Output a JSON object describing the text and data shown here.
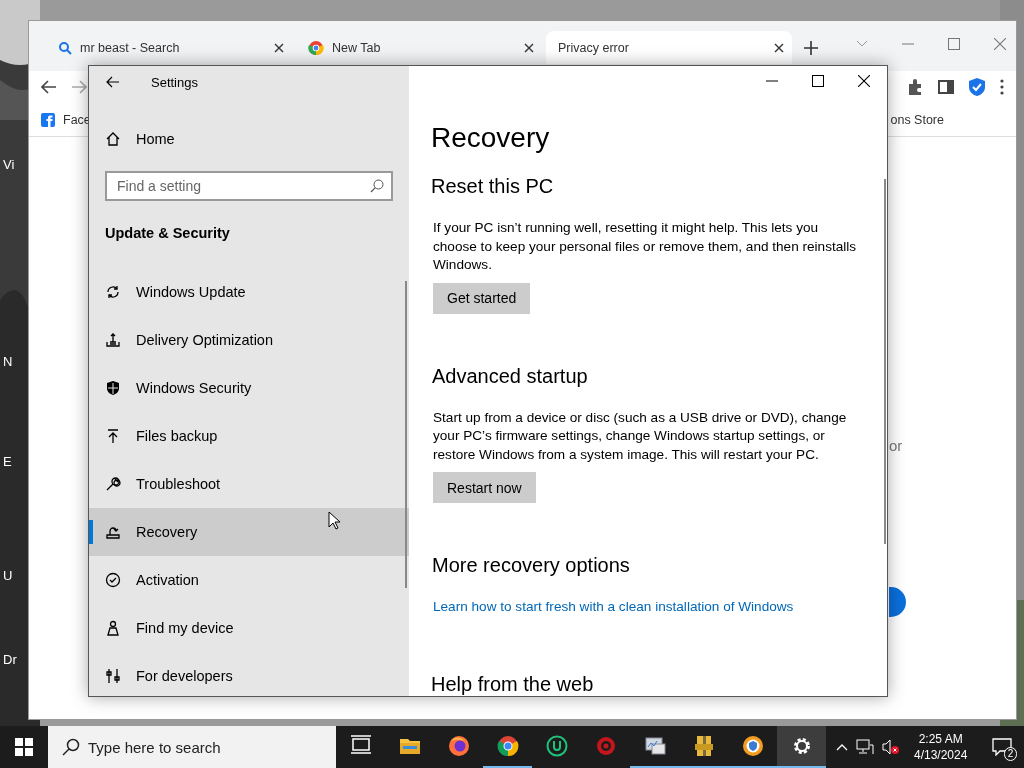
{
  "desktop": {
    "icon_labels": [
      "Vi",
      "N",
      "E",
      "U",
      "Dr"
    ]
  },
  "browser": {
    "tabs": [
      {
        "title": "mr beast - Search",
        "kind": "search",
        "selected": false
      },
      {
        "title": "New Tab",
        "kind": "newtab",
        "selected": false
      },
      {
        "title": "Privacy error",
        "kind": "plain",
        "selected": true
      }
    ],
    "bookmarks": [
      {
        "label": "Face",
        "kind": "facebook"
      },
      {
        "label": "ons Store",
        "kind": "plain"
      }
    ],
    "page_fragment": "or"
  },
  "settings": {
    "title": "Settings",
    "home": "Home",
    "search": {
      "placeholder": "Find a setting"
    },
    "section": "Update & Security",
    "nav": [
      {
        "label": "Windows Update",
        "kind": "sync",
        "selected": false
      },
      {
        "label": "Delivery Optimization",
        "kind": "delivery",
        "selected": false
      },
      {
        "label": "Windows Security",
        "kind": "shield",
        "selected": false
      },
      {
        "label": "Files backup",
        "kind": "backup",
        "selected": false
      },
      {
        "label": "Troubleshoot",
        "kind": "wrench",
        "selected": false
      },
      {
        "label": "Recovery",
        "kind": "recovery",
        "selected": true
      },
      {
        "label": "Activation",
        "kind": "check",
        "selected": false
      },
      {
        "label": "Find my device",
        "kind": "person",
        "selected": false
      },
      {
        "label": "For developers",
        "kind": "developer",
        "selected": false
      }
    ],
    "content": {
      "title": "Recovery",
      "sections": [
        {
          "heading": "Reset this PC",
          "text": "If your PC isn’t running well, resetting it might help. This lets you choose to keep your personal files or remove them, and then reinstalls Windows.",
          "button": "Get started"
        },
        {
          "heading": "Advanced startup",
          "text": "Start up from a device or disc (such as a USB drive or DVD), change your PC’s firmware settings, change Windows startup settings, or restore Windows from a system image. This will restart your PC.",
          "button": "Restart now"
        },
        {
          "heading": "More recovery options",
          "link": "Learn how to start fresh with a clean installation of Windows"
        },
        {
          "heading": "Help from the web"
        }
      ]
    }
  },
  "taskbar": {
    "search_placeholder": "Type here to search",
    "apps": [
      {
        "kind": "taskview",
        "running": false,
        "selected": false
      },
      {
        "kind": "explorer",
        "running": false,
        "selected": false
      },
      {
        "kind": "firefox",
        "running": false,
        "selected": false
      },
      {
        "kind": "chrome",
        "running": true,
        "selected": false
      },
      {
        "kind": "uapp",
        "running": false,
        "selected": false
      },
      {
        "kind": "redapp",
        "running": false,
        "selected": false
      },
      {
        "kind": "monitor",
        "running": true,
        "selected": false
      },
      {
        "kind": "archive",
        "running": true,
        "selected": false
      },
      {
        "kind": "browser",
        "running": true,
        "selected": false
      },
      {
        "kind": "settings",
        "running": true,
        "selected": true
      }
    ],
    "time": "2:25 AM",
    "date": "4/13/2024",
    "notifications": "2"
  }
}
